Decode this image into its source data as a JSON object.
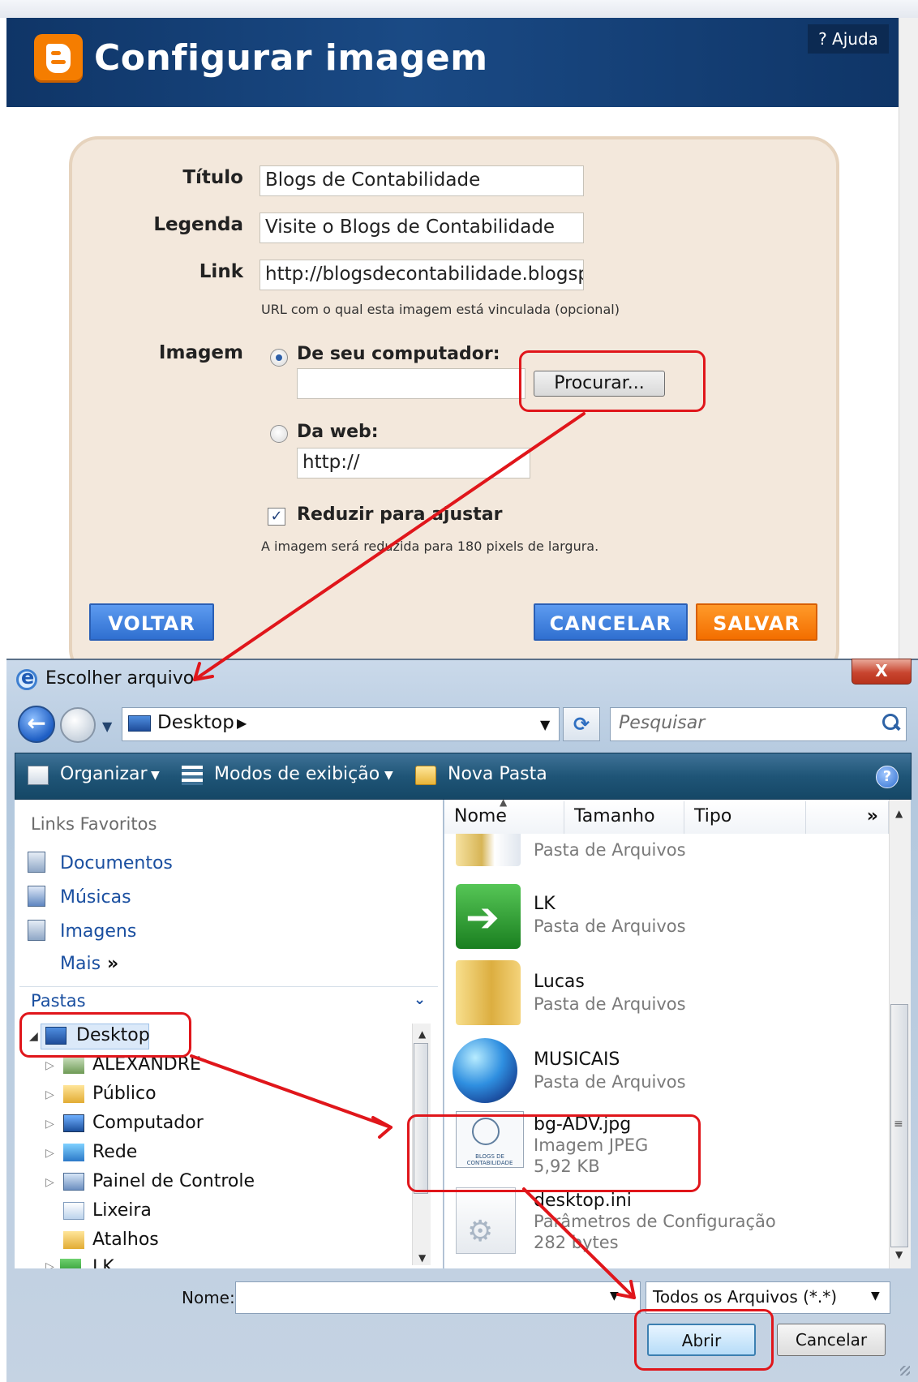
{
  "blogger_dialog": {
    "title": "Configurar imagem",
    "help_link": "? Ajuda",
    "form": {
      "title_label": "Título",
      "title_value": "Blogs de Contabilidade",
      "caption_label": "Legenda",
      "caption_value": "Visite o Blogs de Contabilidade",
      "link_label": "Link",
      "link_value": "http://blogsdecontabilidade.blogspot.",
      "link_hint": "URL com o qual esta imagem está vinculada (opcional)",
      "image_label": "Imagem",
      "option_computer": "De seu computador:",
      "browse_button": "Procurar...",
      "option_web": "Da web:",
      "web_url_value": "http://",
      "reduce_checkbox": "Reduzir para ajustar",
      "reduce_checked": true,
      "reduce_hint": "A imagem será reduzida para 180 pixels de largura."
    },
    "buttons": {
      "back": "VOLTAR",
      "cancel": "CANCELAR",
      "save": "SALVAR"
    }
  },
  "file_dialog": {
    "title": "Escolher arquivo",
    "close_glyph": "X",
    "address": "Desktop",
    "search_placeholder": "Pesquisar",
    "commands": {
      "organize": "Organizar",
      "views": "Modos de exibição",
      "new_folder": "Nova Pasta"
    },
    "favorites_header": "Links Favoritos",
    "favorites": [
      "Documentos",
      "Músicas",
      "Imagens"
    ],
    "more_link": "Mais",
    "folders_header": "Pastas",
    "tree": [
      "Desktop",
      "ALEXANDRE",
      "Público",
      "Computador",
      "Rede",
      "Painel de Controle",
      "Lixeira",
      "Atalhos",
      "LK"
    ],
    "columns": [
      "Nome",
      "Tamanho",
      "Tipo"
    ],
    "files": [
      {
        "name": "",
        "type": "Pasta de Arquivos",
        "size": ""
      },
      {
        "name": "LK",
        "type": "Pasta de Arquivos",
        "size": ""
      },
      {
        "name": "Lucas",
        "type": "Pasta de Arquivos",
        "size": ""
      },
      {
        "name": "MUSICAIS",
        "type": "Pasta de Arquivos",
        "size": ""
      },
      {
        "name": "bg-ADV.jpg",
        "type": "Imagem JPEG",
        "size": "5,92 KB"
      },
      {
        "name": "desktop.ini",
        "type": "Parâmetros de Configuração",
        "size": "282 bytes"
      }
    ],
    "thumbnail_caption": "BLOGS DE CONTABILIDADE",
    "filename_label": "Nome:",
    "filename_value": "",
    "file_type_filter": "Todos os Arquivos (*.*)",
    "open_button": "Abrir",
    "cancel_button": "Cancelar"
  },
  "colors": {
    "blogger_header": "#0f3567",
    "blogger_orange": "#f57d00",
    "blogger_blue_button": "#2f6fd0",
    "annotation_red": "#e0161b",
    "command_bar": "#1f5577"
  }
}
